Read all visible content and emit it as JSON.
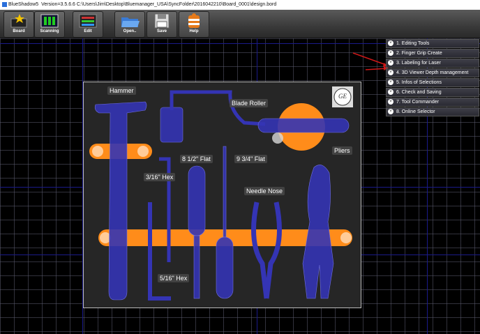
{
  "titlebar": {
    "app": "BlueShadow5",
    "text": "Version=3.5.6.6 C:\\Users\\Jim\\Desktop\\Bluemanager_USA\\SyncFolder\\2016042210\\Board_0001\\design.bord"
  },
  "toolbar": {
    "buttons": [
      {
        "label": "Board",
        "icon": "board-star-icon"
      },
      {
        "label": "Scanning",
        "icon": "scanning-icon"
      },
      {
        "label": "Edit",
        "icon": "edit-icon"
      },
      {
        "label": "Open..",
        "icon": "open-folder-icon"
      },
      {
        "label": "Save",
        "icon": "save-disk-icon"
      },
      {
        "label": "Help",
        "icon": "help-icon"
      }
    ]
  },
  "menu": {
    "items": [
      {
        "label": "1. Editing Tools"
      },
      {
        "label": "2. Finger Grip Create"
      },
      {
        "label": "3. Labeling for Laser"
      },
      {
        "label": "4. 3D Viewer Depth management"
      },
      {
        "label": "5. Infos of Selections"
      },
      {
        "label": "6. Check and Saving"
      },
      {
        "label": "7. Tool Commander"
      },
      {
        "label": "8. Online Selector"
      }
    ]
  },
  "board": {
    "labels": {
      "hammer": "Hammer",
      "blade_roller": "Blade Roller",
      "pliers": "Pliers",
      "flat_8": "8 1/2\" Flat",
      "flat_9": "9 3/4\" Flat",
      "hex_3_16": "3/16\" Hex",
      "needle_nose": "Needle Nose",
      "hex_5_16": "5/16\" Hex"
    },
    "logo_text": "GE"
  },
  "colors": {
    "tool": "#3434b4",
    "finger_grip": "#ff8c1a",
    "board": "#262626",
    "grid": "#5a5a6e",
    "annotation_arrow": "#d01818"
  }
}
